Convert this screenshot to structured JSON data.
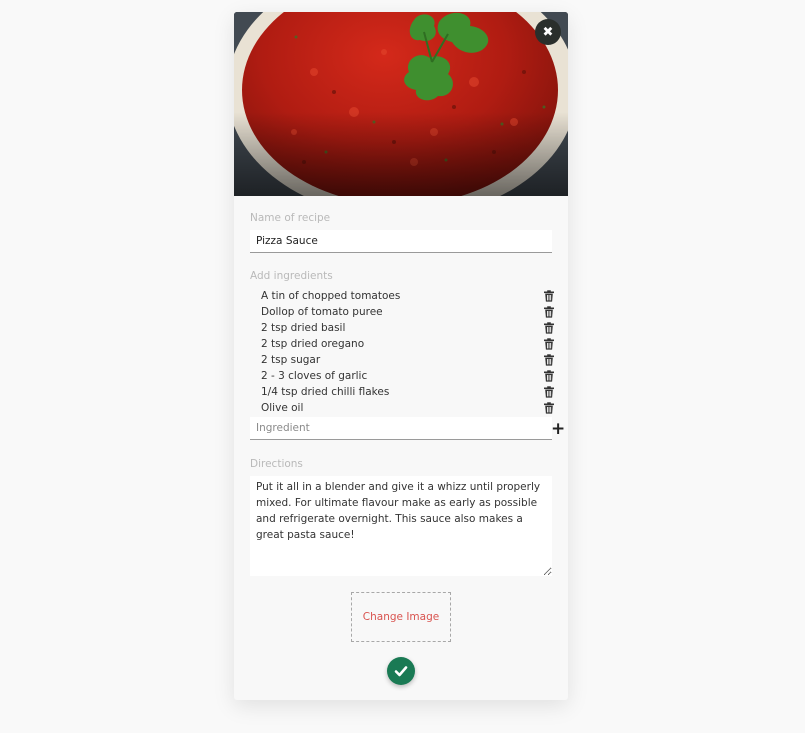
{
  "icons": {
    "close": "close-icon",
    "trash": "trash-icon",
    "add": "plus-icon",
    "save": "check-icon"
  },
  "colors": {
    "save_button": "#1a7a54",
    "change_image_text": "#d9534f",
    "close_button": "#2a2f2c"
  },
  "form": {
    "close_symbol": "✖",
    "name_label": "Name of recipe",
    "name_value": "Pizza Sauce",
    "ingredients_label": "Add ingredients",
    "ingredients": [
      "A tin of chopped tomatoes",
      "Dollop of tomato puree",
      "2 tsp dried basil",
      "2 tsp dried oregano",
      "2 tsp sugar",
      "2 - 3 cloves of garlic",
      "1/4 tsp dried chilli flakes",
      "Olive oil"
    ],
    "ingredient_placeholder": "Ingredient",
    "add_symbol": "+",
    "directions_label": "Directions",
    "directions_value": "Put it all in a blender and give it a whizz until properly mixed. For ultimate flavour make as early as possible and refrigerate overnight. This sauce also makes a great pasta sauce!",
    "change_image_label": "Change Image"
  }
}
